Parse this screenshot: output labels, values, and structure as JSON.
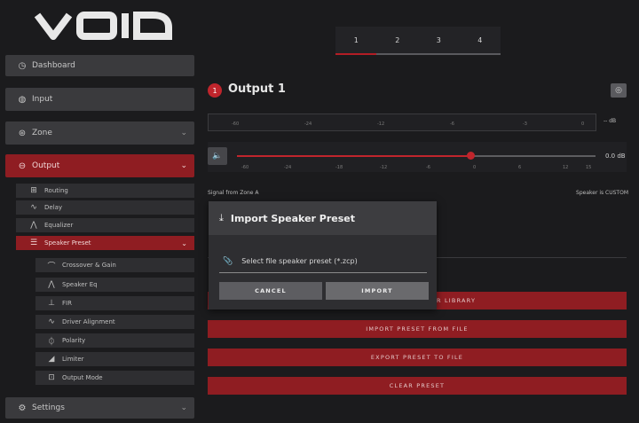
{
  "brand": {
    "logo": "VOID"
  },
  "sidebar": {
    "dashboard": "Dashboard",
    "input": "Input",
    "zone": "Zone",
    "output": "Output",
    "settings": "Settings",
    "output_items": [
      "Routing",
      "Delay",
      "Equalizer",
      "Speaker Preset"
    ],
    "speaker_preset_items": [
      "Crossover & Gain",
      "Speaker Eq",
      "FIR",
      "Driver Alignment",
      "Polarity",
      "Limiter",
      "Output Mode"
    ]
  },
  "tabs": [
    "1",
    "2",
    "3",
    "4"
  ],
  "output": {
    "badge": "1",
    "title": "Output 1",
    "meter_ticks": [
      "-60",
      "-24",
      "-12",
      "-6",
      "-3",
      "0"
    ],
    "meter_value": "-- dB",
    "slider_ticks": [
      "-60",
      "-24",
      "-18",
      "-12",
      "-6",
      "0",
      "6",
      "12",
      "15"
    ],
    "gain_value": "0.0 dB",
    "gain_fraction": 0.65,
    "signal_from": "Signal from Zone A",
    "speaker_is": "Speaker is CUSTOM"
  },
  "actions": {
    "library": "R LIBRARY",
    "import_file": "IMPORT PRESET FROM FILE",
    "export_file": "EXPORT PRESET TO FILE",
    "clear": "CLEAR PRESET"
  },
  "modal": {
    "title": "Import Speaker Preset",
    "field_placeholder": "Select file speaker preset (*.zcp)",
    "cancel": "CANCEL",
    "import": "IMPORT"
  },
  "colors": {
    "accent": "#8f1d22",
    "badge": "#c0252c"
  }
}
